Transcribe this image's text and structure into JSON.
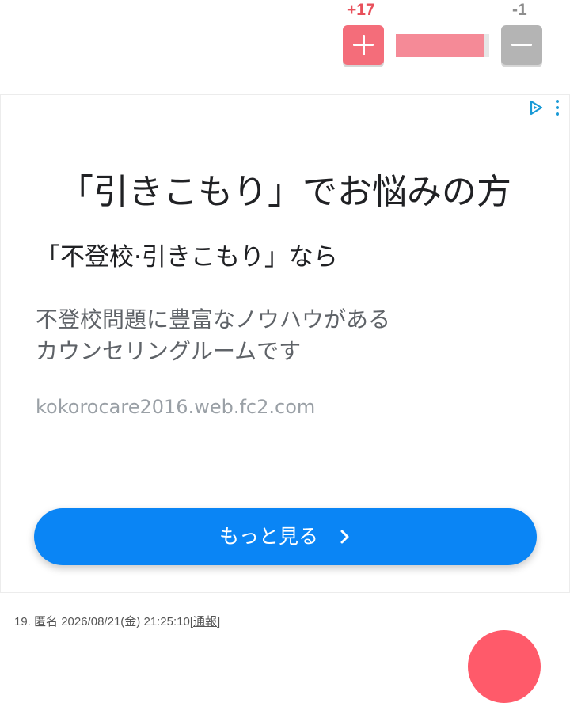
{
  "vote": {
    "plus_count": "+17",
    "minus_count": "-1",
    "ratio": 0.944,
    "plus_color": "#f46d7a",
    "minus_color": "#b4b4b4"
  },
  "ad": {
    "headline": "「引きこもり」でお悩みの方",
    "subheadline": "「不登校·引きこもり」なら",
    "body_line1": "不登校問題に豊富なノウハウがある",
    "body_line2": "カウンセリングルームです",
    "url": "kokorocare2016.web.fc2.com",
    "cta_label": "もっと見る",
    "cta_color": "#0a85f5",
    "icons": [
      "adchoices-icon",
      "ad-menu-icon",
      "chevron-right-icon"
    ]
  },
  "comment": {
    "number": "19.",
    "author": "匿名",
    "datetime": "2026/08/21(金) 21:25:10",
    "report_label": "通報"
  }
}
